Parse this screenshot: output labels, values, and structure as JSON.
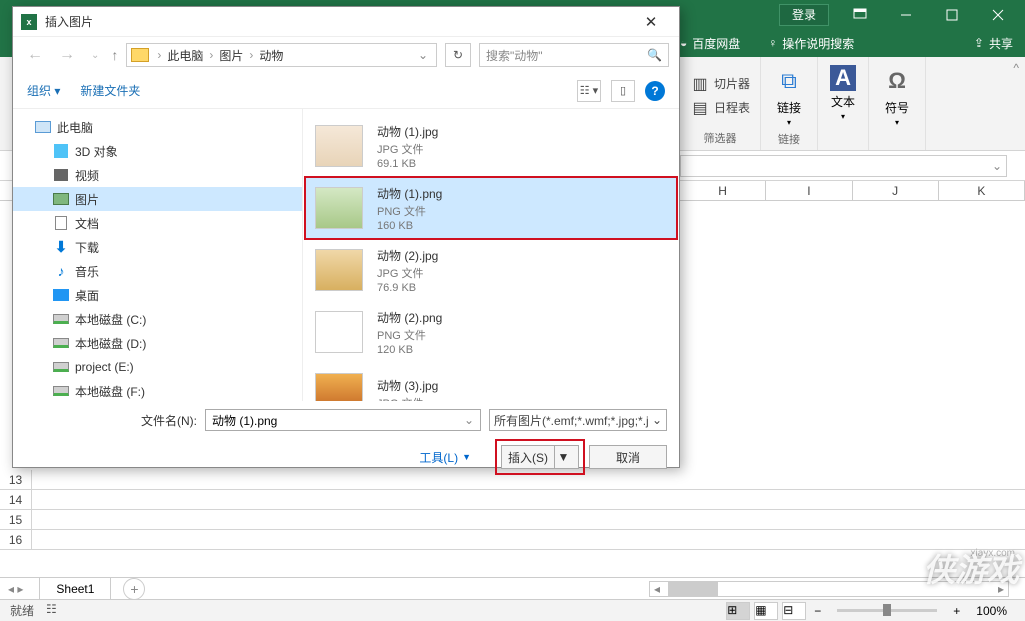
{
  "titlebar": {
    "login": "登录"
  },
  "ribbon": {
    "baidu": "百度网盘",
    "help": "操作说明搜索",
    "share": "共享"
  },
  "groups": {
    "slicer": "切片器",
    "timeline": "日程表",
    "filter_label": "筛选器",
    "link": "链接",
    "link_label": "链接",
    "text": "文本",
    "symbol": "符号"
  },
  "columns": [
    "H",
    "I",
    "J",
    "K"
  ],
  "rows": [
    "13",
    "14",
    "15",
    "16"
  ],
  "sheet": "Sheet1",
  "status": {
    "ready": "就绪",
    "acc": "",
    "zoom": "100%"
  },
  "dialog": {
    "title": "插入图片",
    "path": {
      "pc": "此电脑",
      "pics": "图片",
      "animals": "动物"
    },
    "search_placeholder": "搜索\"动物\"",
    "organize": "组织",
    "new_folder": "新建文件夹",
    "tree": {
      "pc": "此电脑",
      "d3": "3D 对象",
      "video": "视频",
      "pictures": "图片",
      "docs": "文档",
      "downloads": "下载",
      "music": "音乐",
      "desktop": "桌面",
      "drvC": "本地磁盘 (C:)",
      "drvD": "本地磁盘 (D:)",
      "drvE": "project (E:)",
      "drvF": "本地磁盘 (F:)"
    },
    "files": [
      {
        "name": "动物 (1).jpg",
        "type": "JPG 文件",
        "size": "69.1 KB"
      },
      {
        "name": "动物 (1).png",
        "type": "PNG 文件",
        "size": "160 KB"
      },
      {
        "name": "动物 (2).jpg",
        "type": "JPG 文件",
        "size": "76.9 KB"
      },
      {
        "name": "动物 (2).png",
        "type": "PNG 文件",
        "size": "120 KB"
      },
      {
        "name": "动物 (3).jpg",
        "type": "JPG 文件",
        "size": ""
      }
    ],
    "filename_label": "文件名(N):",
    "filename_value": "动物 (1).png",
    "filter": "所有图片(*.emf;*.wmf;*.jpg;*.j",
    "tools": "工具(L)",
    "insert": "插入(S)",
    "cancel": "取消"
  },
  "watermark": "侠游戏",
  "wm_sub": "xiayx.com"
}
